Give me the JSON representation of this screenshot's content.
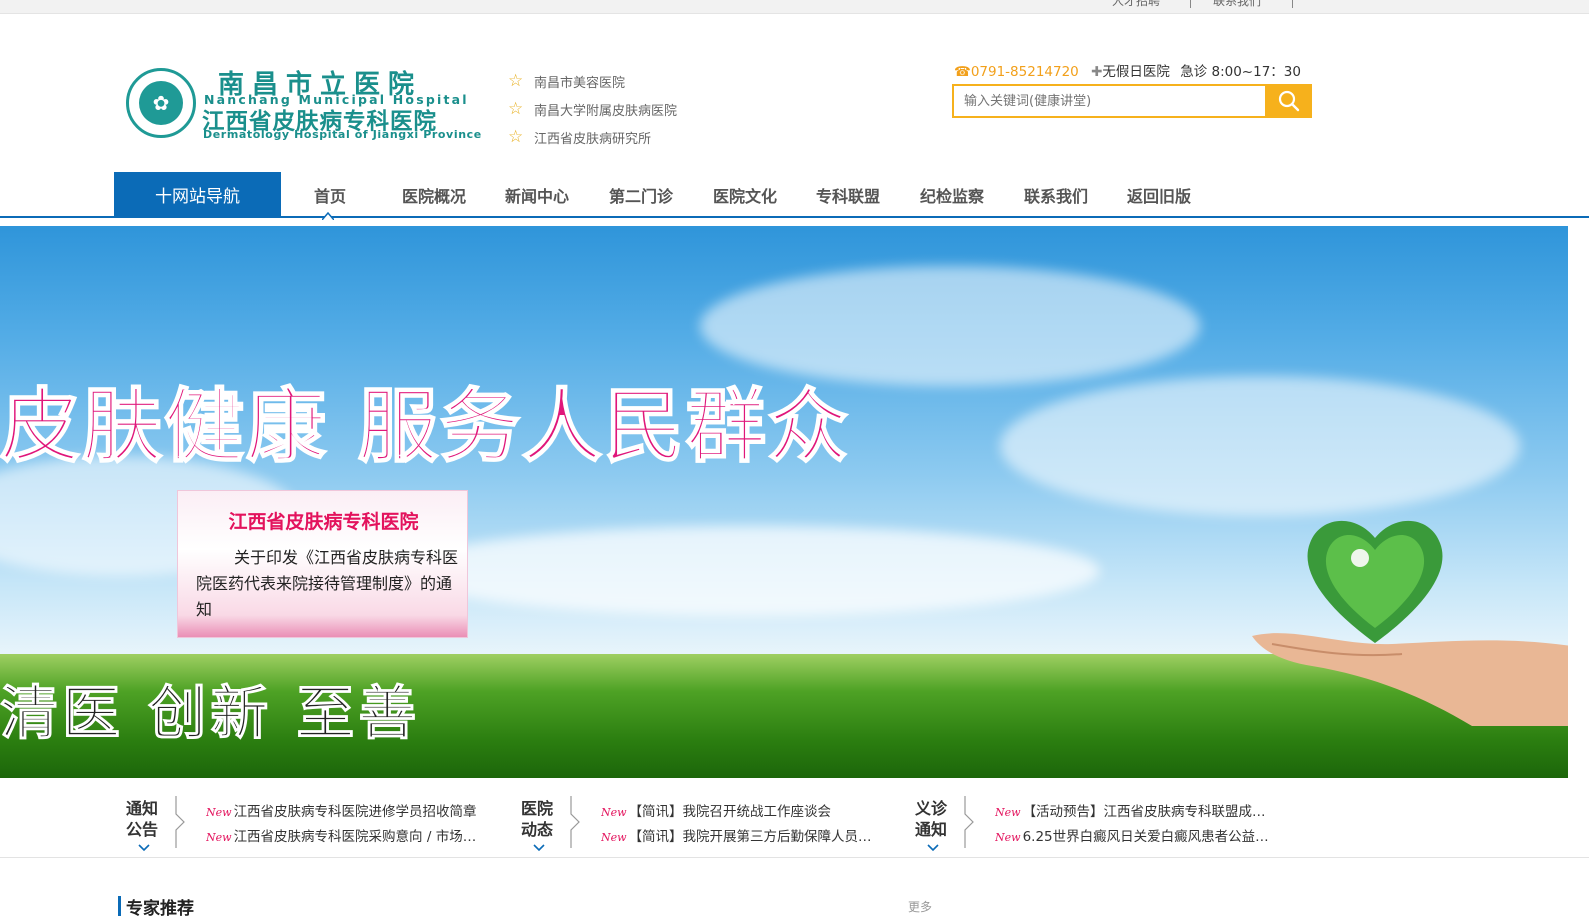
{
  "topbar": {
    "links": [
      "人才招聘",
      "联系我们"
    ]
  },
  "logo": {
    "cn_name": "南昌市立医院",
    "en_name": "Nanchang Municipal Hospital",
    "cn_name2": "江西省皮肤病专科医院",
    "en_name2": "Dermatology Hospital of Jiangxi Province"
  },
  "affiliations": [
    "南昌市美容医院",
    "南昌大学附属皮肤病医院",
    "江西省皮肤病研究所"
  ],
  "contact": {
    "phone": "0791-85214720",
    "holiday": "无假日医院",
    "emergency": "急诊 8:00~17：30"
  },
  "search": {
    "placeholder": "输入关键词(健康讲堂)"
  },
  "nav": {
    "site_nav": "十网站导航",
    "items": [
      "首页",
      "医院概况",
      "新闻中心",
      "第二门诊",
      "医院文化",
      "专科联盟",
      "纪检监察",
      "联系我们",
      "返回旧版"
    ]
  },
  "banner": {
    "slogan": "皮肤健康 服务人民群众",
    "slogan2": "清医 创新 至善",
    "notice_title": "江西省皮肤病专科医院",
    "notice_body": "关于印发《江西省皮肤病专科医院医药代表来院接待管理制度》的通知"
  },
  "news": [
    {
      "label_top": "通知",
      "label_bottom": "公告",
      "items": [
        "江西省皮肤病专科医院进修学员招收简章",
        "江西省皮肤病专科医院采购意向 / 市场…"
      ]
    },
    {
      "label_top": "医院",
      "label_bottom": "动态",
      "items": [
        "【简讯】我院召开统战工作座谈会",
        "【简讯】我院开展第三方后勤保障人员…"
      ]
    },
    {
      "label_top": "义诊",
      "label_bottom": "通知",
      "items": [
        "【活动预告】江西省皮肤病专科联盟成…",
        "6.25世界白癜风日关爱白癜风患者公益…"
      ]
    }
  ],
  "new_tag": "New",
  "section": {
    "title": "专家推荐",
    "more": "更多"
  },
  "colors": {
    "primary": "#0b6bb7",
    "accent": "#f6b11c",
    "brand": "#1a8f8c",
    "highlight": "#e3135d"
  }
}
